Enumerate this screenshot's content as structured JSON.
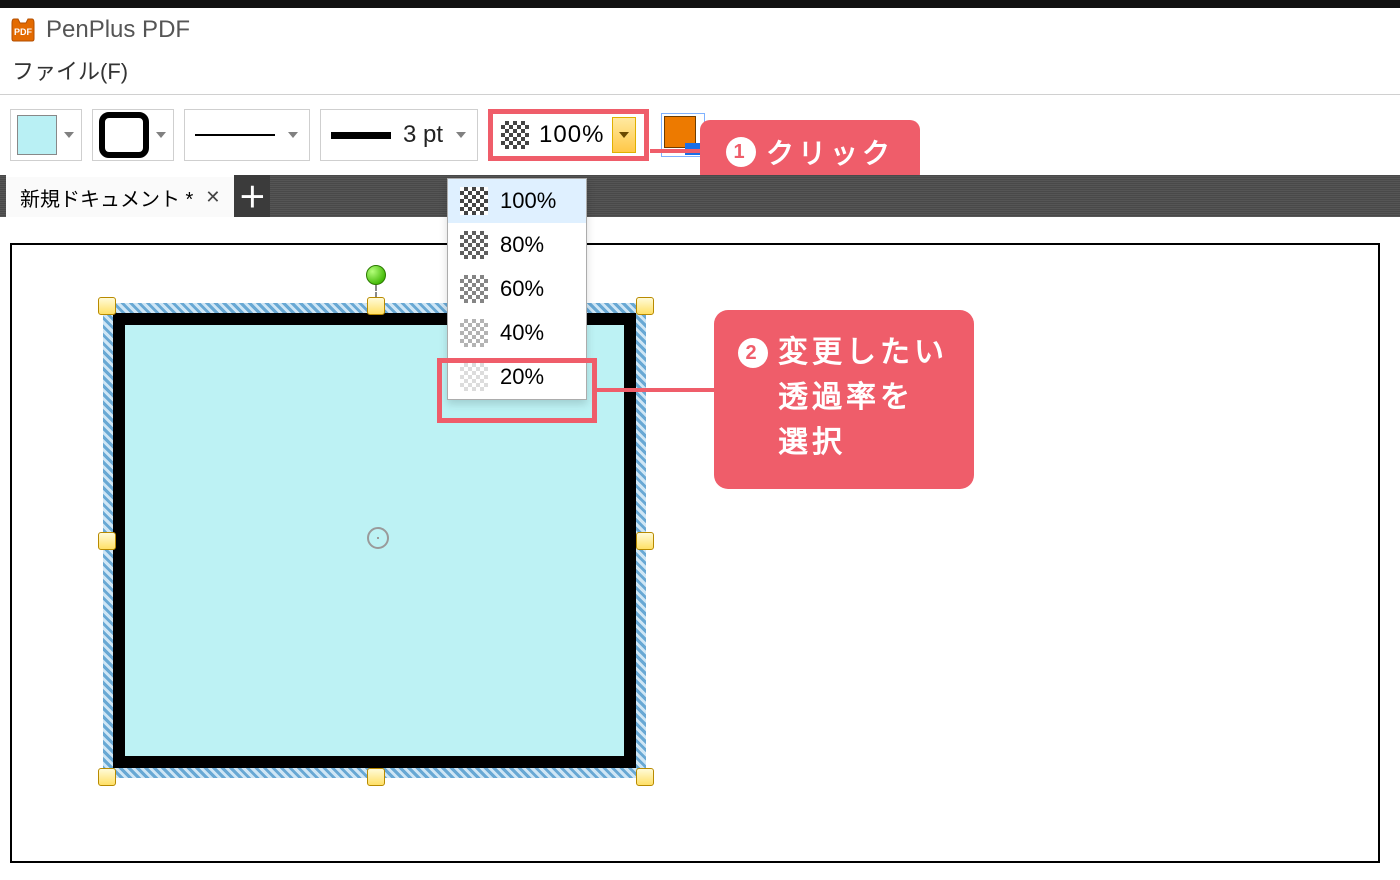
{
  "app": {
    "title": "PenPlus PDF"
  },
  "menu": {
    "file_label": "ファイル(F)"
  },
  "toolbar": {
    "fill_color": "#b9f0f4",
    "line_width_label": "3 pt",
    "opacity_value": "100%"
  },
  "tabs": {
    "active_label": "新規ドキュメント *"
  },
  "dropdown": {
    "options": [
      "100%",
      "80%",
      "60%",
      "40%",
      "20%"
    ],
    "selected_index": 0
  },
  "callouts": {
    "c1": "クリック",
    "c1_num": "1",
    "c2_num": "2",
    "c2_line1": "変更したい",
    "c2_line2": "透過率を",
    "c2_line3": "選択"
  }
}
